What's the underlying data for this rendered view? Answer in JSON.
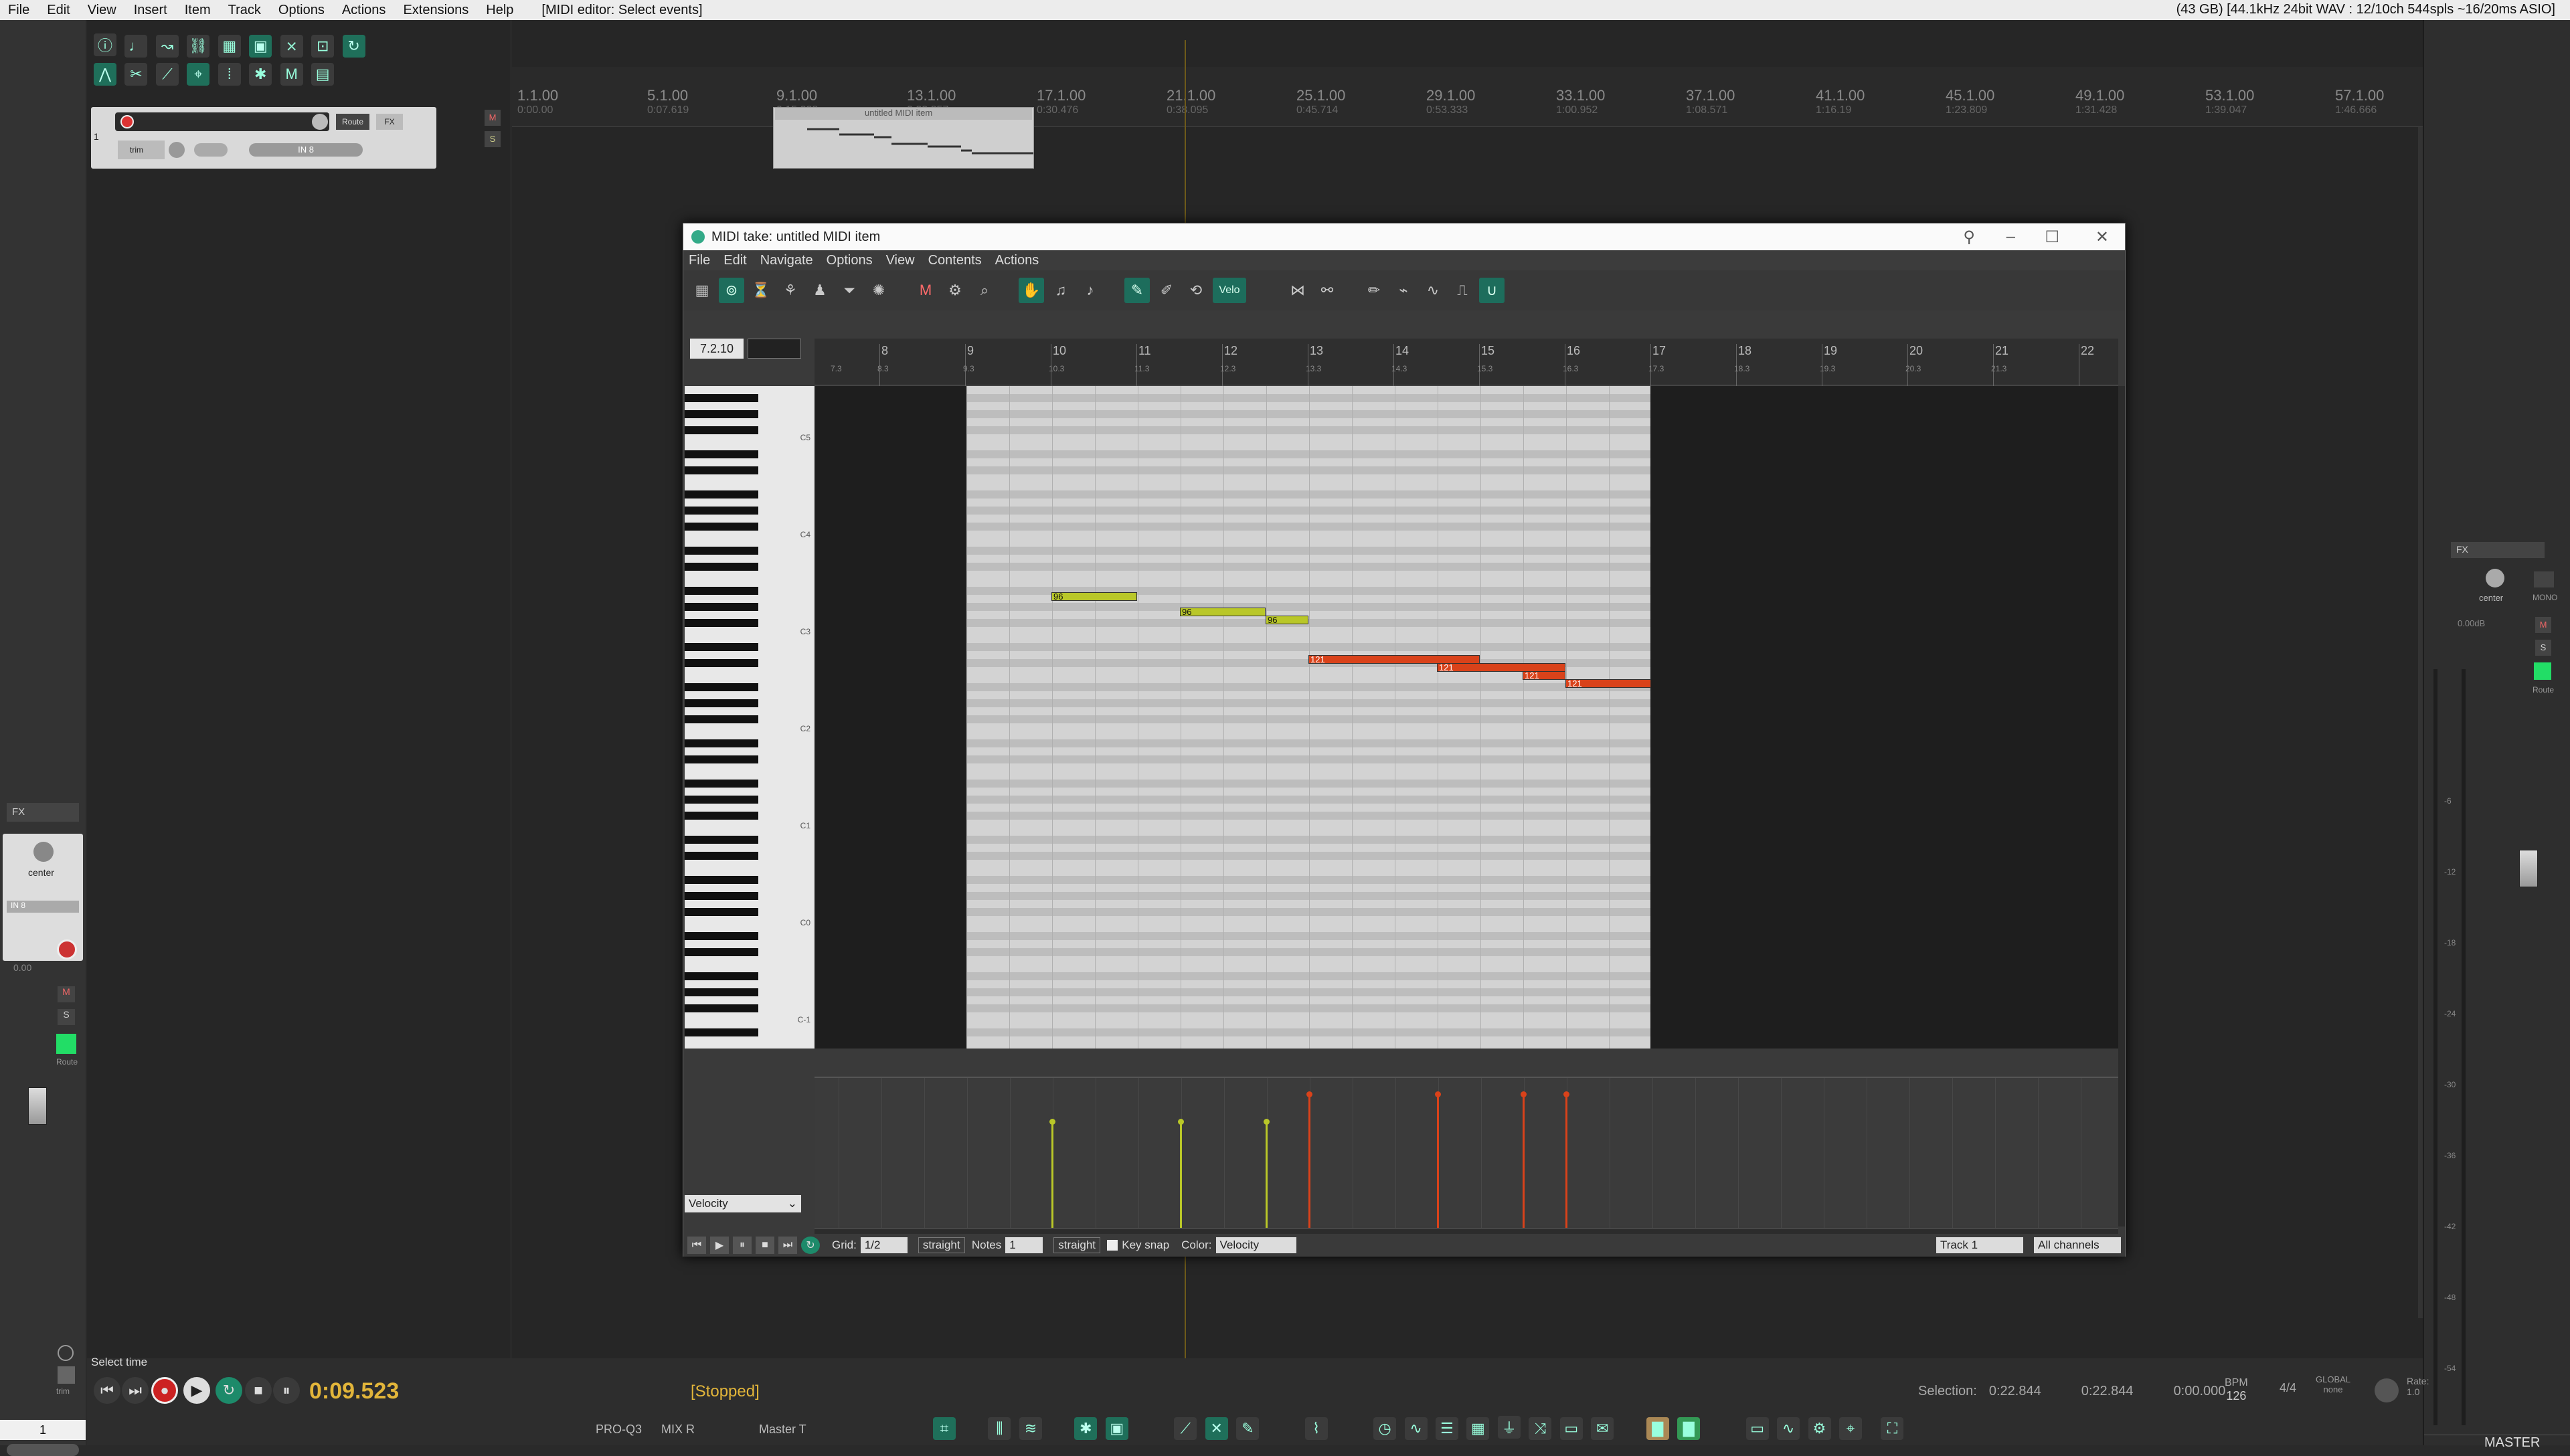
{
  "menubar": {
    "items": [
      "File",
      "Edit",
      "View",
      "Insert",
      "Item",
      "Track",
      "Options",
      "Actions",
      "Extensions",
      "Help"
    ],
    "window_title": "[MIDI editor: Select events]",
    "status": "(43 GB) [44.1kHz 24bit WAV : 12/10ch 544spls ~16/20ms ASIO]"
  },
  "ruler": {
    "ticks": [
      {
        "bar": "1.1.00",
        "time": "0:00.00"
      },
      {
        "bar": "5.1.00",
        "time": "0:07.619"
      },
      {
        "bar": "9.1.00",
        "time": "0:15.238"
      },
      {
        "bar": "13.1.00",
        "time": "0:22.857"
      },
      {
        "bar": "17.1.00",
        "time": "0:30.476"
      },
      {
        "bar": "21.1.00",
        "time": "0:38.095"
      },
      {
        "bar": "25.1.00",
        "time": "0:45.714"
      },
      {
        "bar": "29.1.00",
        "time": "0:53.333"
      },
      {
        "bar": "33.1.00",
        "time": "1:00.952"
      },
      {
        "bar": "37.1.00",
        "time": "1:08.571"
      },
      {
        "bar": "41.1.00",
        "time": "1:16.19"
      },
      {
        "bar": "45.1.00",
        "time": "1:23.809"
      },
      {
        "bar": "49.1.00",
        "time": "1:31.428"
      },
      {
        "bar": "53.1.00",
        "time": "1:39.047"
      },
      {
        "bar": "57.1.00",
        "time": "1:46.666"
      }
    ]
  },
  "track": {
    "number": "1",
    "route_label": "Route",
    "fx_label": "FX",
    "trim_label": "trim",
    "input_label": "IN 8",
    "mute": "M",
    "solo": "S"
  },
  "arrange_item": {
    "name": "untitled MIDI item"
  },
  "midi_editor": {
    "title": "MIDI take: untitled MIDI item",
    "menu": [
      "File",
      "Edit",
      "Navigate",
      "Options",
      "View",
      "Contents",
      "Actions"
    ],
    "position": "7.2.10",
    "velo_button": "Velo",
    "ruler": [
      {
        "major": "",
        "minor": "7.3"
      },
      {
        "major": "8",
        "minor": "8.3"
      },
      {
        "major": "9",
        "minor": "9.3"
      },
      {
        "major": "10",
        "minor": "10.3"
      },
      {
        "major": "11",
        "minor": "11.3"
      },
      {
        "major": "12",
        "minor": "12.3"
      },
      {
        "major": "13",
        "minor": "13.3"
      },
      {
        "major": "14",
        "minor": "14.3"
      },
      {
        "major": "15",
        "minor": "15.3"
      },
      {
        "major": "16",
        "minor": "16.3"
      },
      {
        "major": "17",
        "minor": "17.3"
      },
      {
        "major": "18",
        "minor": "18.3"
      },
      {
        "major": "19",
        "minor": "19.3"
      },
      {
        "major": "20",
        "minor": "20.3"
      },
      {
        "major": "21",
        "minor": "21.3"
      },
      {
        "major": "22",
        "minor": ""
      }
    ],
    "octave_labels": [
      "C5",
      "C4",
      "C3",
      "C2",
      "C1",
      "C0",
      "C-1"
    ],
    "notes": [
      {
        "label": "96",
        "velocity": 96,
        "color": "#b9c728"
      },
      {
        "label": "96",
        "velocity": 96,
        "color": "#b9c728"
      },
      {
        "label": "96",
        "velocity": 96,
        "color": "#b9c728"
      },
      {
        "label": "121",
        "velocity": 121,
        "color": "#d9421a"
      },
      {
        "label": "121",
        "velocity": 121,
        "color": "#d9421a"
      },
      {
        "label": "121",
        "velocity": 121,
        "color": "#d9421a"
      },
      {
        "label": "121",
        "velocity": 121,
        "color": "#d9421a"
      }
    ],
    "cc_lane": "Velocity",
    "bottom": {
      "grid_label": "Grid:",
      "grid_value": "1/2",
      "grid_mode": "straight",
      "notes_label": "Notes",
      "notes_value": "1",
      "notes_mode": "straight",
      "keysnap_label": "Key snap",
      "color_label": "Color:",
      "color_value": "Velocity",
      "track_value": "Track 1",
      "channel_value": "All channels"
    }
  },
  "transport": {
    "select_time_label": "Select time",
    "time": "0:09.523",
    "state": "[Stopped]",
    "selection_label": "Selection:",
    "selection_start": "0:22.844",
    "selection_end": "0:22.844",
    "selection_length": "0:00.000",
    "bpm_label": "BPM",
    "bpm_value": "126",
    "time_sig": "4/4",
    "global_label": "GLOBAL",
    "global_mode": "none",
    "rate_label": "Rate:",
    "rate_value": "1.0"
  },
  "bottom_tabs": [
    "PRO-Q3",
    "MIX R",
    "Master T"
  ],
  "left_strip": {
    "fx_label": "FX",
    "pan_label": "center",
    "input_label": "IN 8",
    "volume": "0.00",
    "route_label": "Route",
    "track_number": "1",
    "mute": "M",
    "solo": "S",
    "trim_label": "trim"
  },
  "master": {
    "fx_label": "FX",
    "pan_label": "center",
    "mono_label": "MONO",
    "volume": "0.00dB",
    "route_label": "Route",
    "name": "MASTER",
    "mute": "M",
    "solo": "S"
  }
}
